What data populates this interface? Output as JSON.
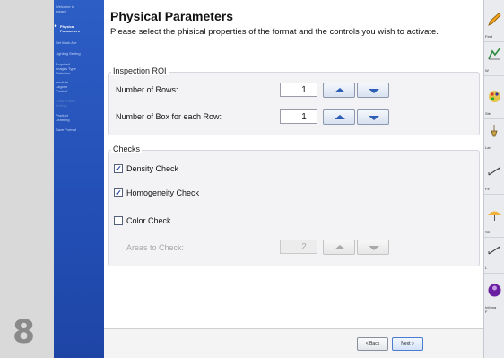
{
  "page_number": "8",
  "sidebar": {
    "items": [
      {
        "label": "Welcome to\nwizard",
        "state": "normal"
      },
      {
        "label": "Physical\nParameters",
        "state": "active"
      },
      {
        "label": "Set Work Are",
        "state": "normal"
      },
      {
        "label": "Lighting Setting",
        "state": "normal"
      },
      {
        "label": "Acquired\nImages Type\nSelection",
        "state": "normal"
      },
      {
        "label": "Insolute\nLagone\nControl",
        "state": "normal"
      },
      {
        "label": "Color Check\nSetting",
        "state": "disabled"
      },
      {
        "label": "Product\nLearning",
        "state": "normal"
      },
      {
        "label": "Save Format",
        "state": "normal"
      }
    ]
  },
  "main": {
    "title": "Physical Parameters",
    "subtitle": "Please select the phisical properties of the format and the controls you wish to activate.",
    "roi_group": {
      "legend": "Inspection ROI",
      "rows_label": "Number of Rows:",
      "rows_value": "1",
      "boxes_label": "Number of Box for each Row:",
      "boxes_value": "1"
    },
    "checks_group": {
      "legend": "Checks",
      "density_label": "Density Check",
      "density_checked": true,
      "homogeneity_label": "Homogeneity Check",
      "homogeneity_checked": true,
      "color_label": "Color Check",
      "color_checked": false,
      "areas_label": "Areas to Check:",
      "areas_value": "2"
    }
  },
  "footer": {
    "back_label": "< Back",
    "next_label": "Next >"
  },
  "toolbar": {
    "items": [
      {
        "icon": "pencil-icon",
        "label": "Feat"
      },
      {
        "icon": "chart-icon",
        "label": "W"
      },
      {
        "icon": "palette-icon",
        "label": "Ste"
      },
      {
        "icon": "lamp-icon",
        "label": "Lar"
      },
      {
        "icon": "measure-icon",
        "label": "Fe"
      },
      {
        "icon": "umbrella-icon",
        "label": "Su"
      },
      {
        "icon": "measure-icon",
        "label": "L"
      },
      {
        "icon": "info-icon",
        "label": "Infoma\nF"
      }
    ]
  },
  "colors": {
    "sidebar": "#2450b6",
    "accent": "#2d5eb6",
    "background": "#d9d9d9"
  }
}
